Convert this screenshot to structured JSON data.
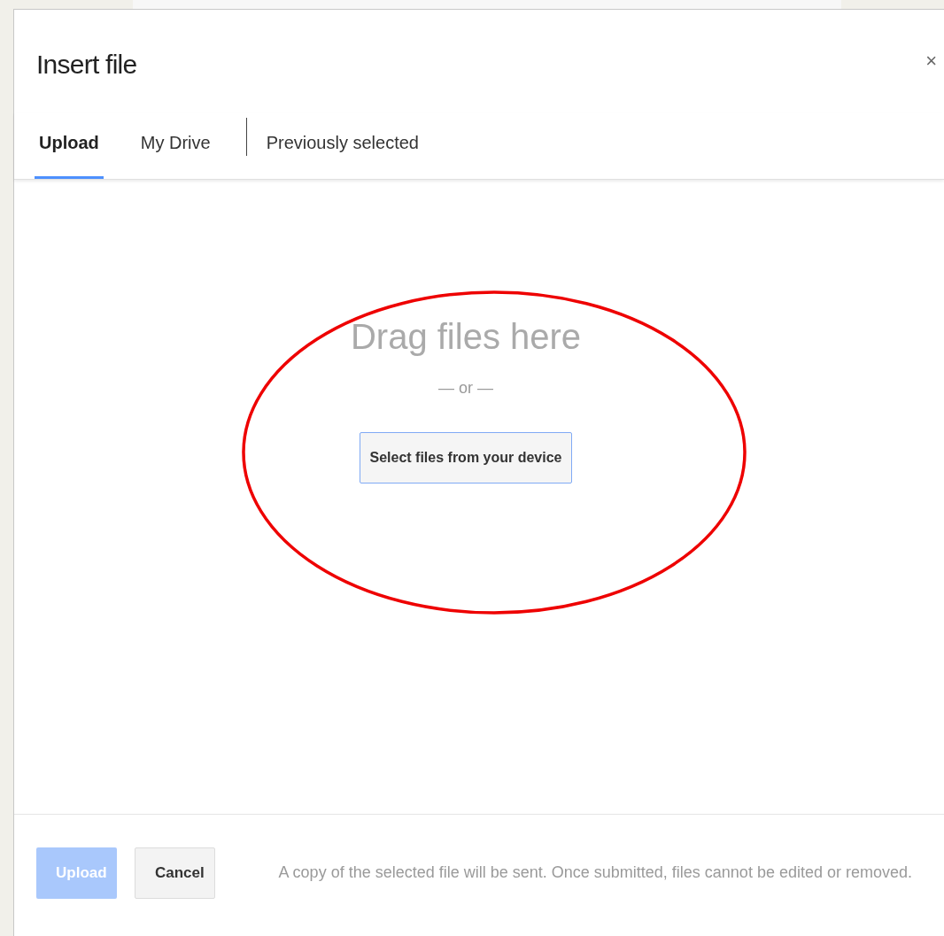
{
  "dialog": {
    "title": "Insert file",
    "close": "×"
  },
  "tabs": [
    {
      "label": "Upload",
      "selected": true
    },
    {
      "label": "My Drive",
      "selected": false
    },
    {
      "label": "Previously selected",
      "selected": false
    }
  ],
  "drop_zone": {
    "heading": "Drag files here",
    "separator": "— or —",
    "button": "Select files from your device"
  },
  "footer": {
    "buttons": [
      {
        "label": "Upload",
        "kind": "primary",
        "disabled": true
      },
      {
        "label": "Cancel",
        "kind": "secondary",
        "disabled": false
      }
    ],
    "note": "A copy of the selected file will be sent. Once submitted, files cannot be edited or removed."
  }
}
